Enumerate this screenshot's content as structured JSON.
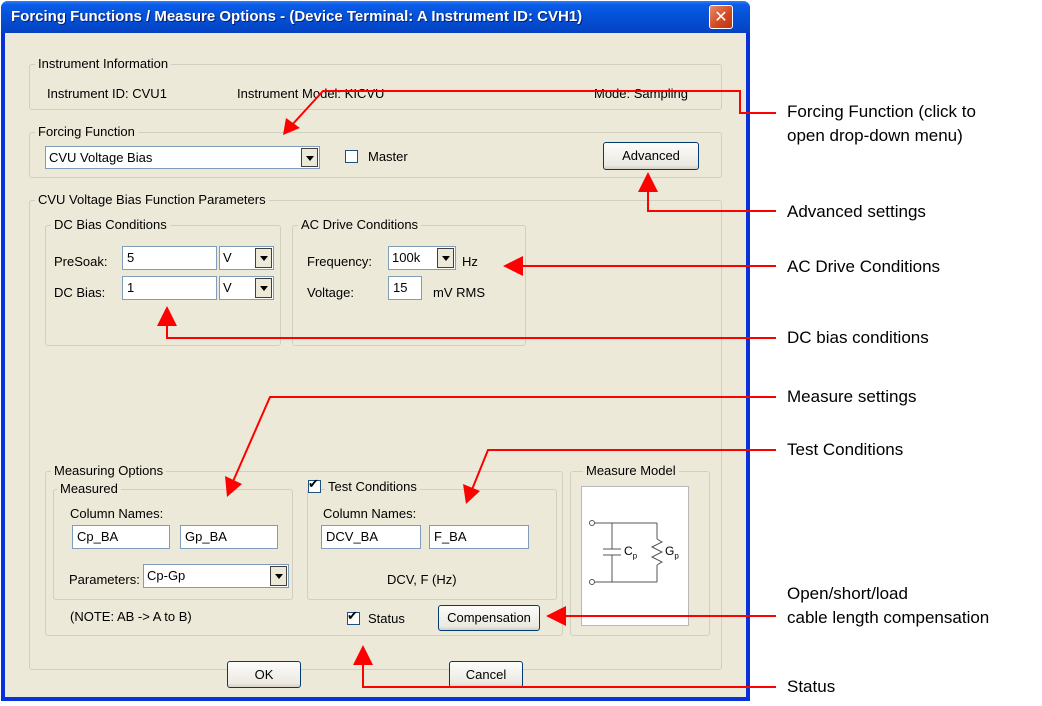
{
  "window": {
    "title": "Forcing Functions / Measure Options - (Device Terminal: A  Instrument ID: CVH1)",
    "close_glyph": "✕"
  },
  "instrument_info": {
    "group_label": "Instrument Information",
    "id_text": "Instrument ID:  CVU1",
    "model_text": "Instrument Model:  KICVU",
    "mode_text": "Mode:  Sampling"
  },
  "forcing_function": {
    "group_label": "Forcing Function",
    "selected": "CVU Voltage Bias",
    "master_label": "Master",
    "master_checked": false,
    "advanced_label": "Advanced"
  },
  "params": {
    "group_label": "CVU Voltage Bias Function Parameters",
    "dc": {
      "group_label": "DC Bias Conditions",
      "presoak_label": "PreSoak:",
      "presoak_value": "5",
      "presoak_unit": "V",
      "dcbias_label": "DC Bias:",
      "dcbias_value": "1",
      "dcbias_unit": "V"
    },
    "ac": {
      "group_label": "AC Drive Conditions",
      "freq_label": "Frequency:",
      "freq_value": "100k",
      "freq_unit": "Hz",
      "volt_label": "Voltage:",
      "volt_value": "15",
      "volt_unit": "mV RMS"
    }
  },
  "measuring": {
    "group_label": "Measuring Options",
    "measured_label": "Measured",
    "column_names_label": "Column Names:",
    "col1": "Cp_BA",
    "col2": "Gp_BA",
    "parameters_label": "Parameters:",
    "parameters_value": "Cp-Gp",
    "note": "(NOTE: AB -> A to B)",
    "test_conditions_label": "Test Conditions",
    "test_conditions_checked": true,
    "tc_column_names_label": "Column Names:",
    "tc_col1": "DCV_BA",
    "tc_col2": "F_BA",
    "tc_units": "DCV, F (Hz)",
    "status_label": "Status",
    "status_checked": true,
    "compensation_label": "Compensation"
  },
  "measure_model": {
    "group_label": "Measure Model",
    "cap_symbol": "C",
    "cap_sub": "p",
    "cond_symbol": "G",
    "cond_sub": "p"
  },
  "footer": {
    "ok_label": "OK",
    "cancel_label": "Cancel"
  },
  "annotations": {
    "forcing_function_line1": "Forcing Function (click to",
    "forcing_function_line2": "open drop-down menu)",
    "advanced": "Advanced settings",
    "ac_drive": "AC Drive Conditions",
    "dc_bias": "DC bias conditions",
    "measure_settings": "Measure settings",
    "test_conditions": "Test Conditions",
    "compensation_line1": "Open/short/load",
    "compensation_line2": "cable length compensation",
    "status": "Status",
    "callout_color": "#ff0000"
  }
}
